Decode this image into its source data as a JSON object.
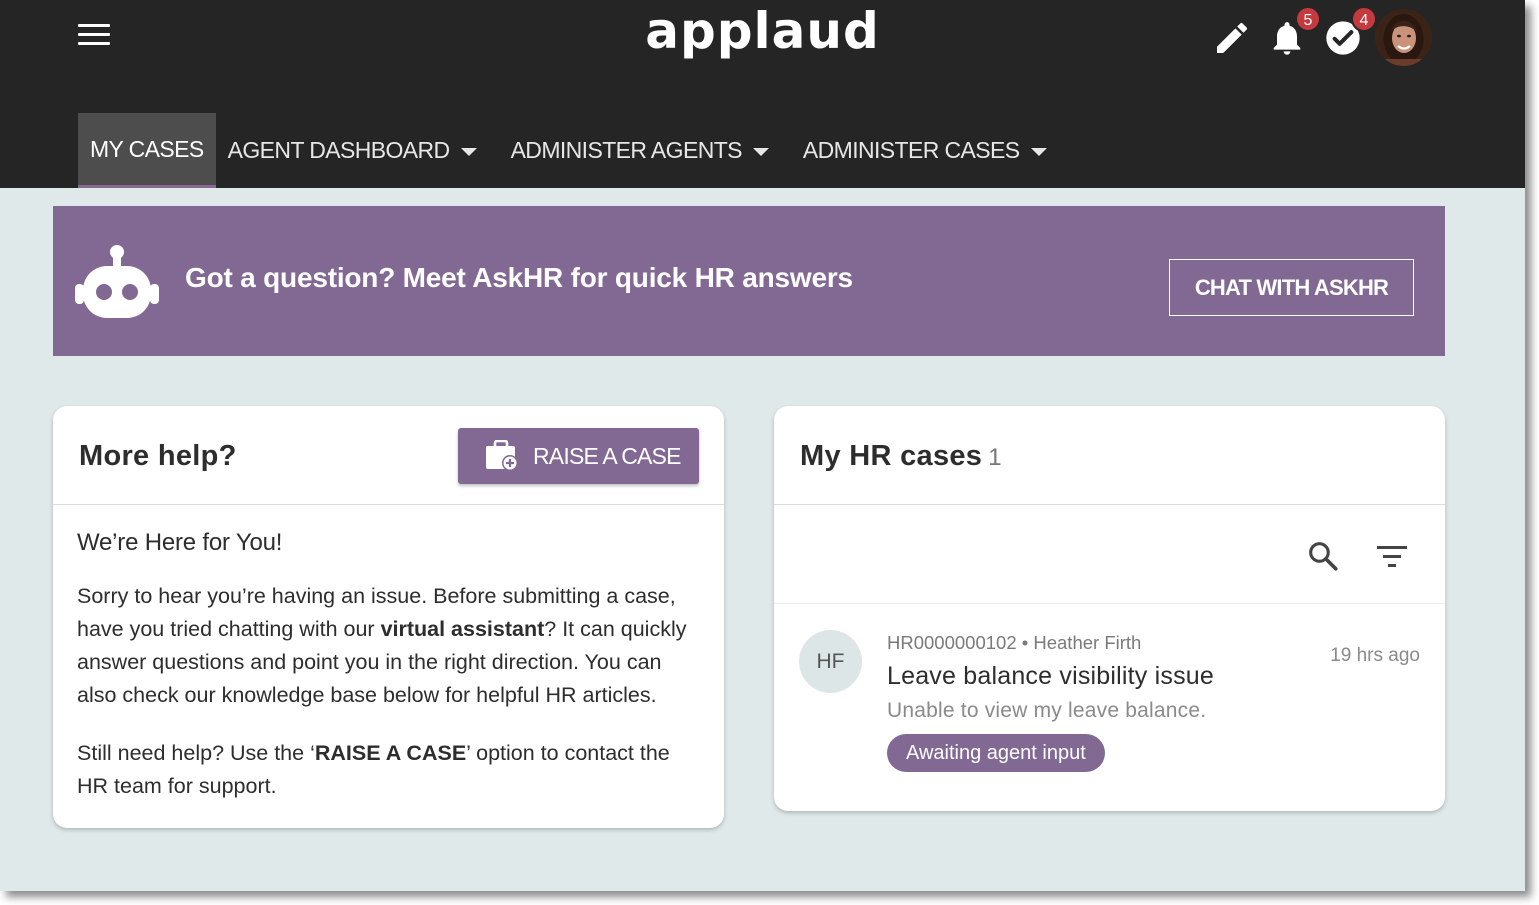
{
  "app": {
    "logo": "applaud"
  },
  "header": {
    "notifications_count": "5",
    "tasks_count": "4",
    "icons": [
      "menu-icon",
      "edit-icon",
      "bell-icon",
      "check-circle-icon",
      "avatar"
    ]
  },
  "nav": {
    "items": [
      {
        "label": "MY CASES",
        "active": true,
        "dropdown": false
      },
      {
        "label": "AGENT DASHBOARD",
        "active": false,
        "dropdown": true
      },
      {
        "label": "ADMINISTER AGENTS",
        "active": false,
        "dropdown": true
      },
      {
        "label": "ADMINISTER CASES",
        "active": false,
        "dropdown": true
      }
    ]
  },
  "banner": {
    "text": "Got a question? Meet AskHR for quick HR answers",
    "button": "CHAT WITH ASKHR",
    "icon": "robot-icon"
  },
  "help_card": {
    "title": "More help?",
    "raise_button": "RAISE A CASE",
    "heading": "We’re Here for You!",
    "para1_a": "Sorry to hear you’re having an issue. Before submitting a case, have you tried chatting with our ",
    "para1_bold": "virtual assistant",
    "para1_b": "? It can quickly answer questions and point you in the right direction. You can also check our knowledge base below for helpful HR articles.",
    "para2_a": "Still need help? Use the ‘",
    "para2_bold": "RAISE A CASE",
    "para2_b": "’ option to contact the HR team for support."
  },
  "cases_card": {
    "title": "My HR cases",
    "count": "1",
    "cases": [
      {
        "initials": "HF",
        "meta": "HR0000000102 • Heather Firth",
        "title": "Leave balance visibility issue",
        "description": "Unable to view my leave balance.",
        "time": "19 hrs ago",
        "status": "Awaiting agent input"
      }
    ]
  },
  "colors": {
    "header_bg": "#252525",
    "accent_purple": "#826993",
    "page_bg": "#e0e9ea",
    "badge_red": "#c53a3f"
  }
}
